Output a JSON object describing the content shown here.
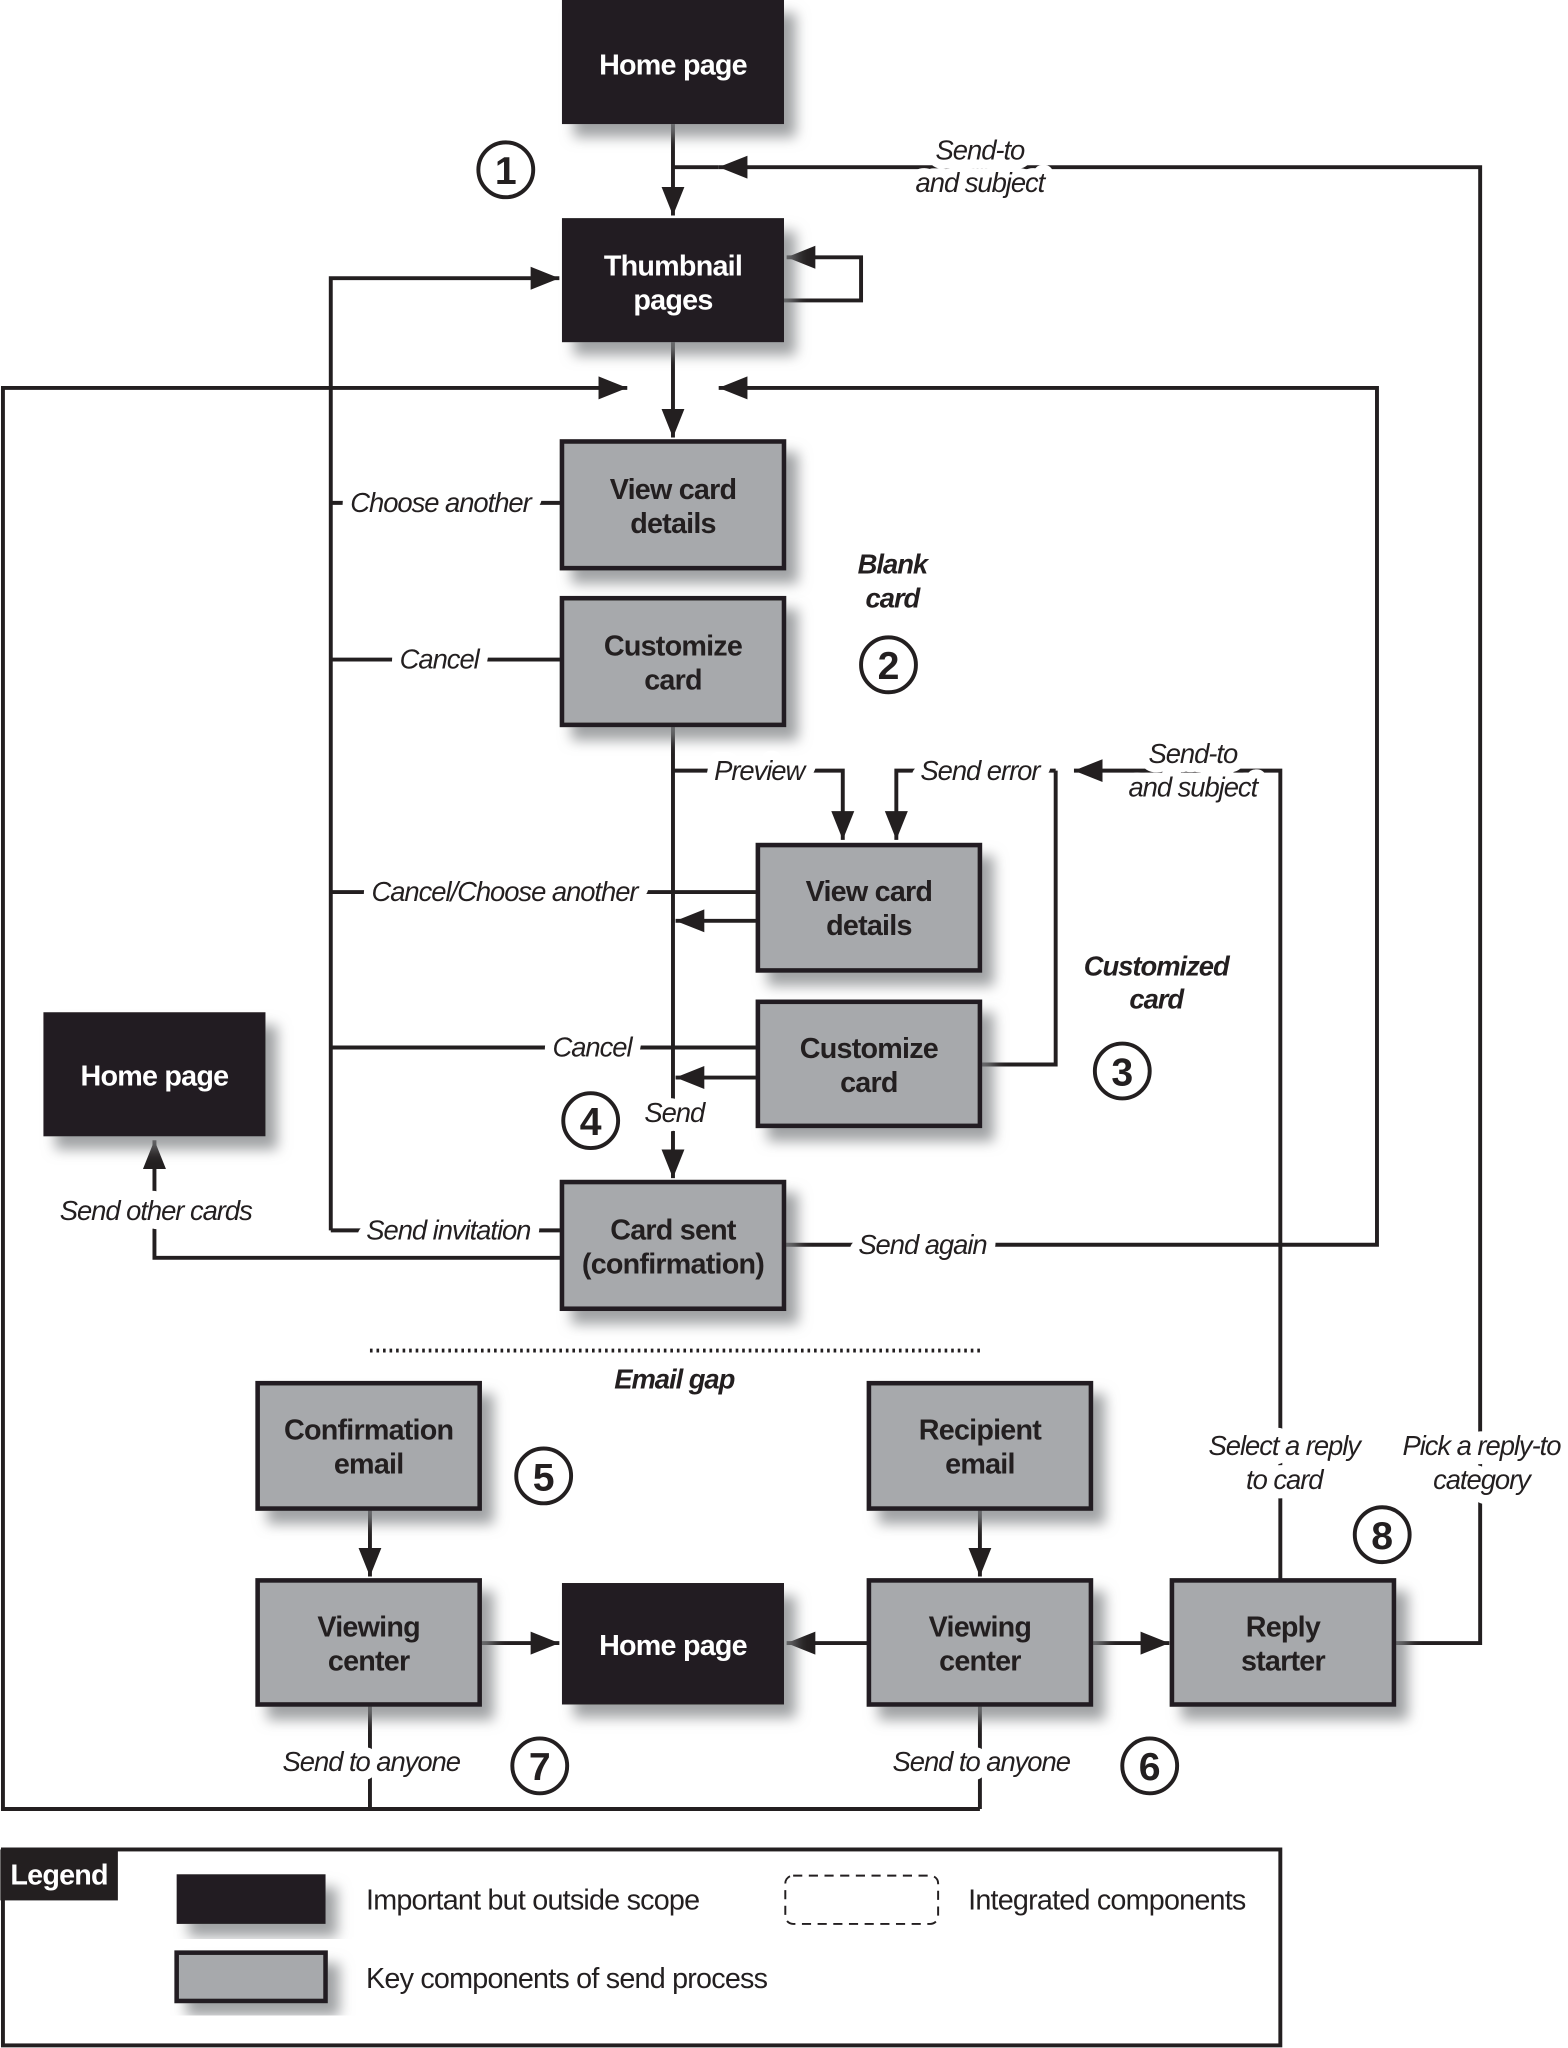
{
  "colors": {
    "outside_scope": "#231f20",
    "key_component": "#a7a9ac",
    "line": "#231f20"
  },
  "nodes": {
    "home_top": [
      "Home page"
    ],
    "thumbnail": [
      "Thumbnail",
      "pages"
    ],
    "view_card_1": [
      "View card",
      "details"
    ],
    "customize_1": [
      "Customize",
      "card"
    ],
    "view_card_2": [
      "View card",
      "details"
    ],
    "customize_2": [
      "Customize",
      "card"
    ],
    "home_left": [
      "Home page"
    ],
    "card_sent": [
      "Card sent",
      "(confirmation)"
    ],
    "confirmation_email": [
      "Confirmation",
      "email"
    ],
    "recipient_email": [
      "Recipient",
      "email"
    ],
    "viewing_center_left": [
      "Viewing",
      "center"
    ],
    "home_bottom": [
      "Home page"
    ],
    "viewing_center_right": [
      "Viewing",
      "center"
    ],
    "reply_starter": [
      "Reply",
      "starter"
    ]
  },
  "edge_labels": {
    "send_to_subject_top": [
      "Send-to",
      "and subject"
    ],
    "choose_another": "Choose another",
    "cancel_1": "Cancel",
    "preview": "Preview",
    "send_error": "Send error",
    "send_to_subject_mid": [
      "Send-to",
      "and subject"
    ],
    "cancel_choose_another": "Cancel/Choose another",
    "cancel_2": "Cancel",
    "send": "Send",
    "send_other_cards": "Send other cards",
    "send_invitation": "Send invitation",
    "send_again": "Send again",
    "select_reply": [
      "Select a reply",
      "to card"
    ],
    "pick_reply_to": [
      "Pick a reply-to",
      "category"
    ],
    "send_to_anyone_left": "Send to anyone",
    "send_to_anyone_right": "Send to anyone"
  },
  "section_labels": {
    "blank_card": [
      "Blank",
      "card"
    ],
    "customized_card": [
      "Customized",
      "card"
    ],
    "email_gap": "Email gap"
  },
  "step_numbers": [
    "1",
    "2",
    "3",
    "4",
    "5",
    "6",
    "7",
    "8"
  ],
  "legend": {
    "title": "Legend",
    "items": [
      {
        "style": "dark",
        "label": "Important but outside scope"
      },
      {
        "style": "gray",
        "label": "Key components of send process"
      },
      {
        "style": "dashed",
        "label": "Integrated components"
      }
    ]
  }
}
